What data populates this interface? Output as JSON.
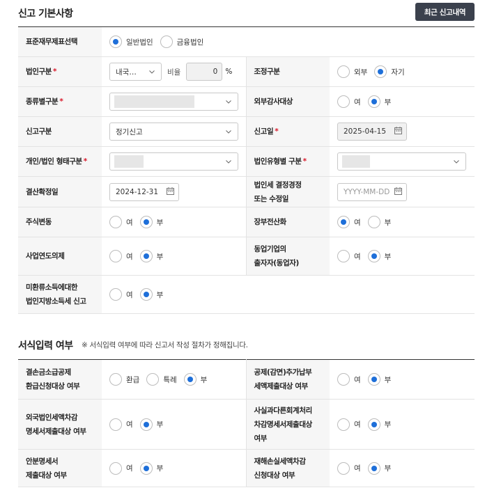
{
  "sections": {
    "basic_title": "신고 기본사항",
    "input_title": "서식입력 여부",
    "input_note": "※ 서식입력 여부에 따라 신고서 작성 절차가 정해집니다."
  },
  "buttons": {
    "history": "최근 신고내역"
  },
  "basic": {
    "std_fs": {
      "label": "표준재무제표선택",
      "options": [
        "일반법인",
        "금융법인"
      ],
      "selected": "일반법인"
    },
    "corp_type": {
      "label": "법인구분",
      "required": "*",
      "select_value": "내국…",
      "ratio_label": "비율",
      "ratio_value": "0",
      "ratio_unit": "%"
    },
    "adjust_type": {
      "label": "조정구분",
      "options": [
        "외부",
        "자기"
      ],
      "selected": "자기"
    },
    "kind_type": {
      "label": "종류별구분",
      "required": "*"
    },
    "ext_audit": {
      "label": "외부감사대상",
      "options": [
        "여",
        "부"
      ],
      "selected": "부"
    },
    "report_type": {
      "label": "신고구분",
      "select_value": "정기신고"
    },
    "report_date": {
      "label": "신고일",
      "required": "*",
      "value": "2025-04-15"
    },
    "form_type": {
      "label": "개인/법인 형태구분",
      "required": "*"
    },
    "corp_kind": {
      "label": "법인유형별 구분",
      "required": "*"
    },
    "settle_date": {
      "label": "결산확정일",
      "value": "2024-12-31"
    },
    "tax_fix_date": {
      "label_1": "법인세 결정경정",
      "label_2": "또는 수정일",
      "placeholder": "YYYY-MM-DD"
    },
    "stock_change": {
      "label": "주식변동",
      "options": [
        "여",
        "부"
      ],
      "selected": "부"
    },
    "ledger_comp": {
      "label": "장부전산화",
      "options": [
        "여",
        "부"
      ],
      "selected": "여"
    },
    "fiscal_year": {
      "label": "사업연도의제",
      "options": [
        "여",
        "부"
      ],
      "selected": "부"
    },
    "partner": {
      "label_1": "동업기업의",
      "label_2": "출자자(동업자)",
      "options": [
        "여",
        "부"
      ],
      "selected": "부"
    },
    "unreturned": {
      "label_1": "미환류소득에대한",
      "label_2": "법인지방소득세 신고",
      "options": [
        "여",
        "부"
      ],
      "selected": "부"
    }
  },
  "input": {
    "loss_refund": {
      "label_1": "결손금소급공제",
      "label_2": "환급신청대상 여부",
      "options": [
        "환급",
        "특례",
        "부"
      ],
      "selected": "부"
    },
    "deduction": {
      "label_1": "공제(감면)추가납부",
      "label_2": "세액제출대상 여부",
      "options": [
        "여",
        "부"
      ],
      "selected": "부"
    },
    "foreign": {
      "label_1": "외국법인세액차감",
      "label_2": "명세서제출대상 여부",
      "options": [
        "여",
        "부"
      ],
      "selected": "부"
    },
    "fact": {
      "label_1": "사실과다른회계처리",
      "label_2": "차감명세서제출대상",
      "label_3": "여부",
      "options": [
        "여",
        "부"
      ],
      "selected": "부"
    },
    "allocation": {
      "label_1": "안분명세서",
      "label_2": "제출대상 여부",
      "options": [
        "여",
        "부"
      ],
      "selected": "부"
    },
    "disaster": {
      "label_1": "재해손실세액차감",
      "label_2": "신청대상 여부",
      "options": [
        "여",
        "부"
      ],
      "selected": "부"
    }
  },
  "colors": {
    "accent": "#1e6fd9",
    "required": "#d9192b",
    "button_bg": "#3b414d",
    "label_bg": "#f6f6f6"
  }
}
